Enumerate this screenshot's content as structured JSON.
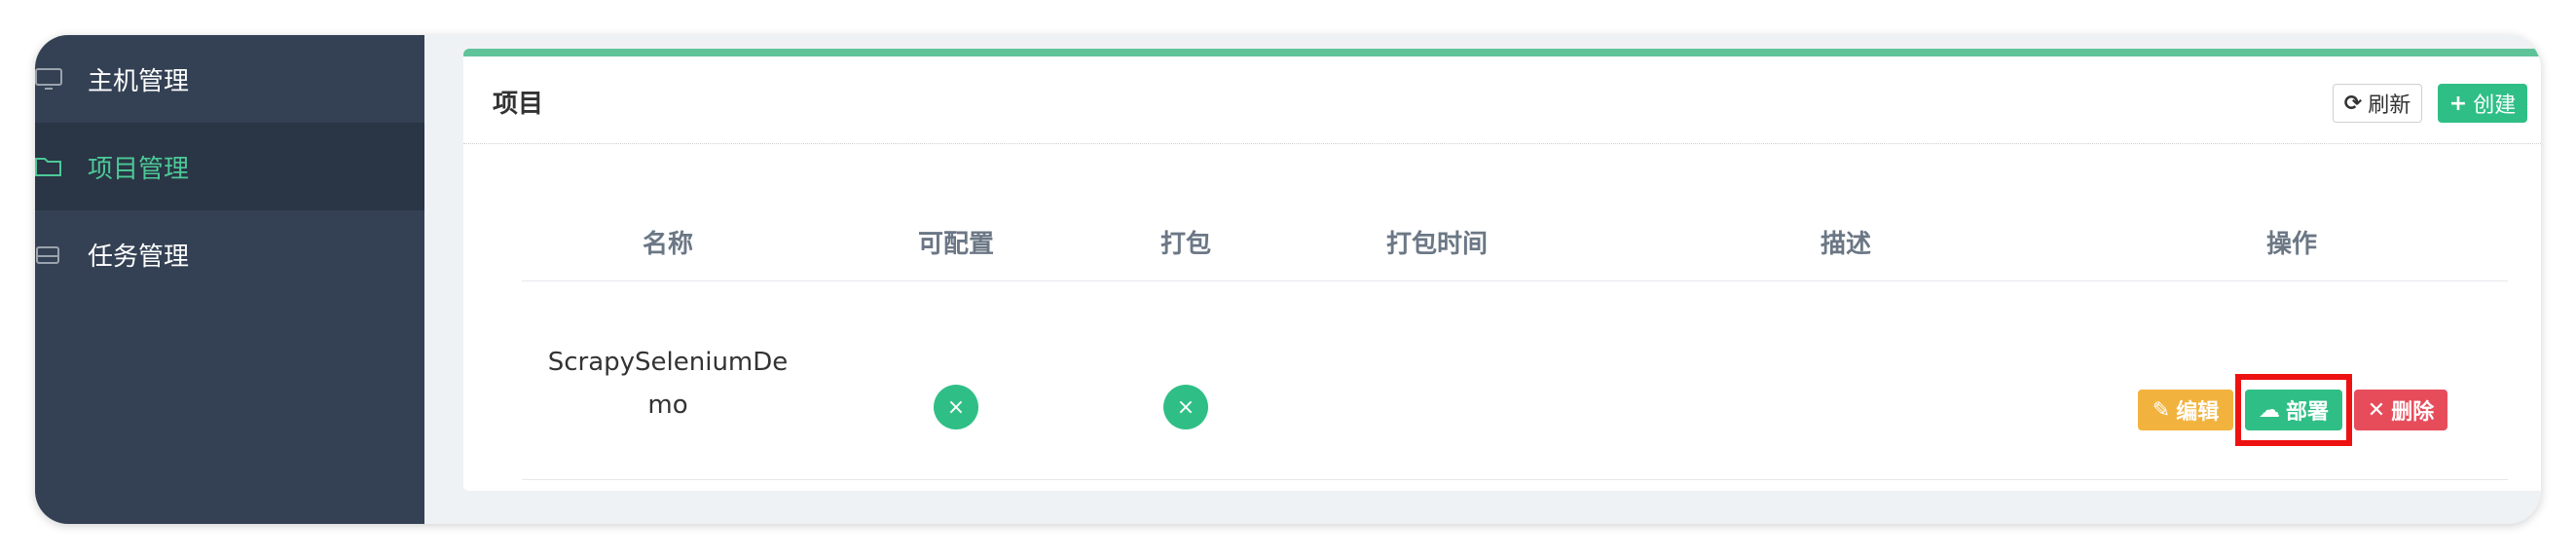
{
  "sidebar": {
    "items": [
      {
        "label": "主机管理",
        "icon": "monitor-icon",
        "active": false
      },
      {
        "label": "项目管理",
        "icon": "folder-icon",
        "active": true
      },
      {
        "label": "任务管理",
        "icon": "drive-icon",
        "active": false
      }
    ]
  },
  "card": {
    "title": "项目",
    "refresh_label": "刷新",
    "create_label": "创建",
    "accent_color": "#5fc39a"
  },
  "table": {
    "headers": [
      "名称",
      "可配置",
      "打包",
      "打包时间",
      "描述",
      "操作"
    ],
    "rows": [
      {
        "name_line1": "ScrapySeleniumDe",
        "name_line2": "mo",
        "configurable": "×",
        "built": "×",
        "build_time": "",
        "description": "",
        "actions": {
          "edit": "编辑",
          "deploy": "部署",
          "delete": "删除"
        }
      }
    ]
  },
  "colors": {
    "sidebar_bg": "#344154",
    "sidebar_active_text": "#4cc997",
    "edit": "#f2b33e",
    "deploy": "#2fbf86",
    "delete": "#e74c5a",
    "highlight": "#ee1111"
  }
}
